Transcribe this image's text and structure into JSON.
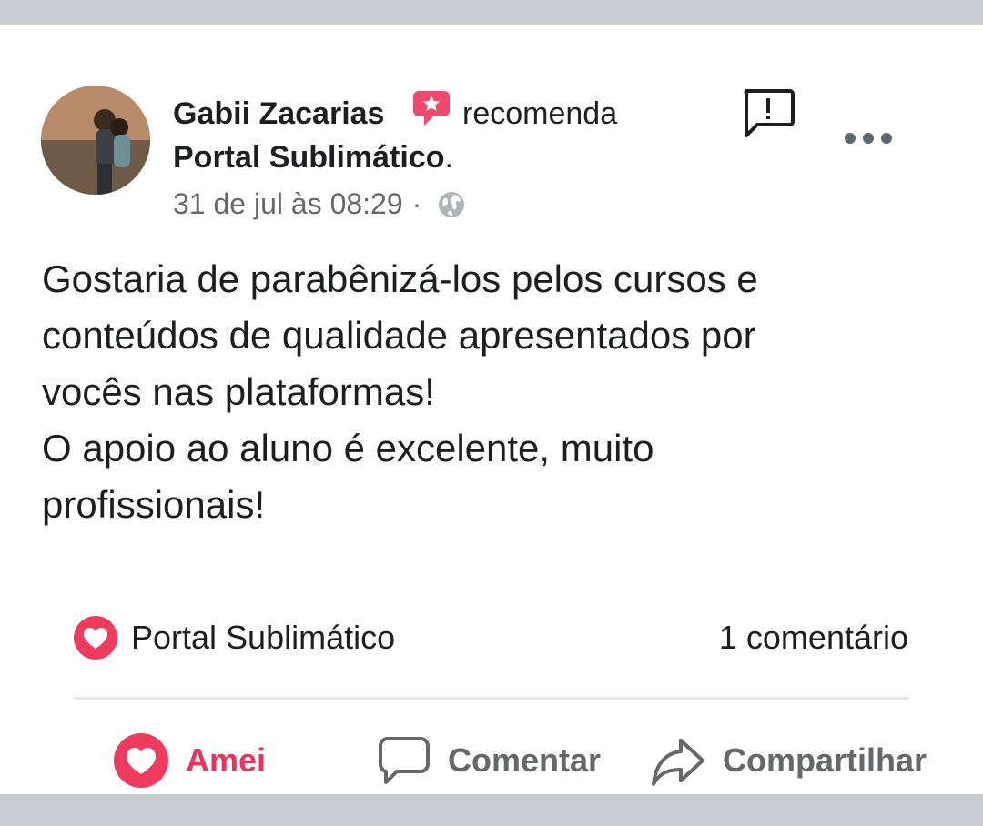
{
  "post": {
    "author": "Gabii Zacarias",
    "action_text": "recomenda",
    "page_name": "Portal Sublimático",
    "page_suffix": ".",
    "timestamp": "31 de jul às 08:29",
    "separator": "·",
    "privacy_icon": "globe-icon",
    "body_lines": [
      "Gostaria de parabênizá-los pelos cursos e",
      "conteúdos de qualidade apresentados por",
      "vocês nas plataformas!",
      "O apoio ao aluno é excelente, muito",
      "profissionais!"
    ]
  },
  "reactions": {
    "icon": "heart-icon",
    "reacted_by": "Portal Sublimático",
    "comments": "1 comentário"
  },
  "actions": {
    "love": "Amei",
    "comment": "Comentar",
    "share": "Compartilhar"
  },
  "colors": {
    "accent": "#e8345a",
    "text": "#1c1e21",
    "secondary": "#65676b",
    "frame": "#c9ccd1"
  }
}
